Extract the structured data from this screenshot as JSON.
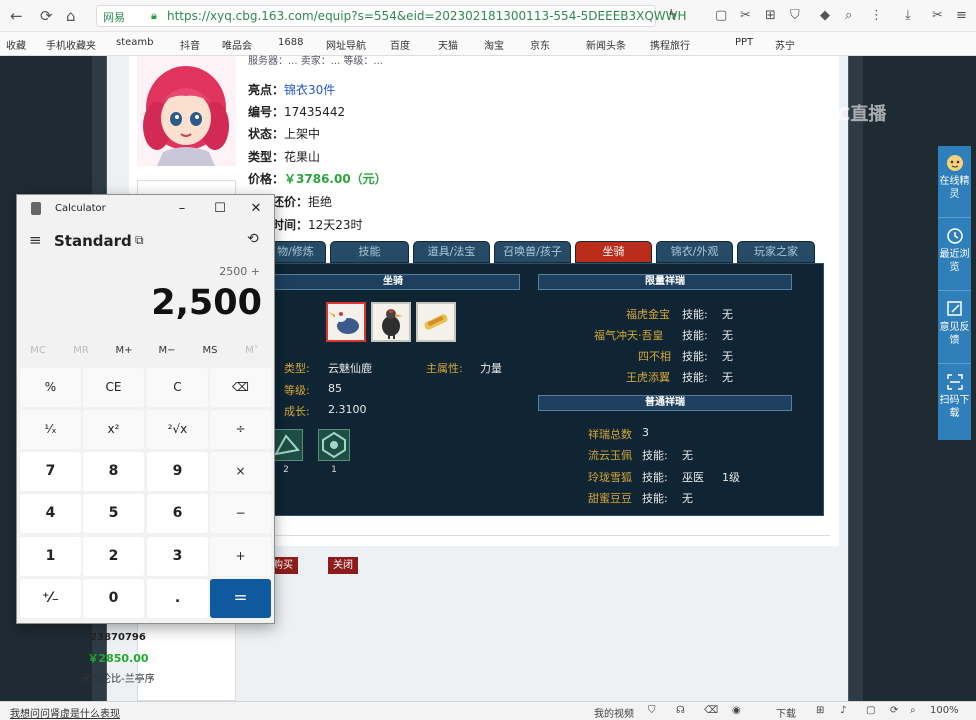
{
  "browser": {
    "site_tag": "网易",
    "url": "https://xyq.cbg.163.com/equip?s=554&eid=202302181300113-554-5DEEEB3XQWWH"
  },
  "bookmarks": [
    "收藏",
    "手机收藏夹",
    "steamb",
    "抖音",
    "唯品会",
    "1688",
    "网址导航",
    "百度",
    "天猫",
    "淘宝",
    "京东",
    "新闻头条",
    "携程旅行",
    "PPT",
    "苏宁"
  ],
  "listing": {
    "header_fragment": "服务器：... 卖家：... 等级：...",
    "rows": [
      {
        "label": "亮点：",
        "value": "锦衣30件"
      },
      {
        "label": "编号：",
        "value": "17435442"
      },
      {
        "label": "状态：",
        "value": "上架中"
      },
      {
        "label": "类型：",
        "value": "花果山"
      },
      {
        "label": "价格：",
        "value": "￥3786.00（元）"
      },
      {
        "label": "接受还价：",
        "value": "拒绝"
      },
      {
        "label": "剩余时间：",
        "value": "12天23时"
      }
    ]
  },
  "tabs": [
    "物/修炼",
    "技能",
    "道具/法宝",
    "召唤兽/孩子",
    "坐骑",
    "锦衣/外观",
    "玩家之家"
  ],
  "mount": {
    "header": "坐骑",
    "type_label": "类型:",
    "type_value": "云魅仙鹿",
    "attr_label": "主属性:",
    "attr_value": "力量",
    "level_label": "等级:",
    "level_value": "85",
    "growth_label": "成长:",
    "growth_value": "2.3100",
    "skill_counts": [
      "2",
      "1"
    ]
  },
  "xiangrui": {
    "limited_header": "限量祥瑞",
    "limited": [
      {
        "name": "福虎金宝",
        "label": "技能:",
        "value": "无"
      },
      {
        "name": "福气冲天·吾皇",
        "label": "技能:",
        "value": "无"
      },
      {
        "name": "四不相",
        "label": "技能:",
        "value": "无"
      },
      {
        "name": "王虎添翼",
        "label": "技能:",
        "value": "无"
      }
    ],
    "normal_header": "普通祥瑞",
    "total_label": "祥瑞总数",
    "total_value": "3",
    "normal": [
      {
        "name": "流云玉佩",
        "label": "技能:",
        "value": "无",
        "extra": ""
      },
      {
        "name": "玲珑雪狐",
        "label": "技能:",
        "value": "巫医",
        "extra": "1级"
      },
      {
        "name": "甜蜜豆豆",
        "label": "技能:",
        "value": "无",
        "extra": ""
      }
    ]
  },
  "buttons": {
    "buy": "购买",
    "close": "关闭"
  },
  "product_card": {
    "id": "23870796",
    "price": "￥2850.00",
    "seller": "无与伦比-兰亭序"
  },
  "float_bar": [
    "在线精灵",
    "最近浏览",
    "意见反馈",
    "扫码下载"
  ],
  "watermark": "CC直播",
  "status_bar": {
    "left_text": "我想问问肾虚是什么表现",
    "items": [
      "我的视频",
      "下载",
      "100%"
    ]
  },
  "calculator": {
    "app_title": "Calculator",
    "mode": "Standard",
    "expression": "2500 +",
    "display": "2,500",
    "memory": [
      "MC",
      "MR",
      "M+",
      "M−",
      "MS",
      "M˅"
    ],
    "keys": [
      "%",
      "CE",
      "C",
      "⌫",
      "¹⁄ₓ",
      "x²",
      "²√x",
      "÷",
      "7",
      "8",
      "9",
      "×",
      "4",
      "5",
      "6",
      "−",
      "1",
      "2",
      "3",
      "+",
      "⁺⁄₋",
      "0",
      ".",
      "="
    ]
  },
  "colors": {
    "accent_red": "#b92d1a",
    "calc_equals": "#0f5a9f",
    "price_green": "#2aa53b",
    "panel_bg": "#0f2534",
    "gold_text": "#d6a637"
  }
}
